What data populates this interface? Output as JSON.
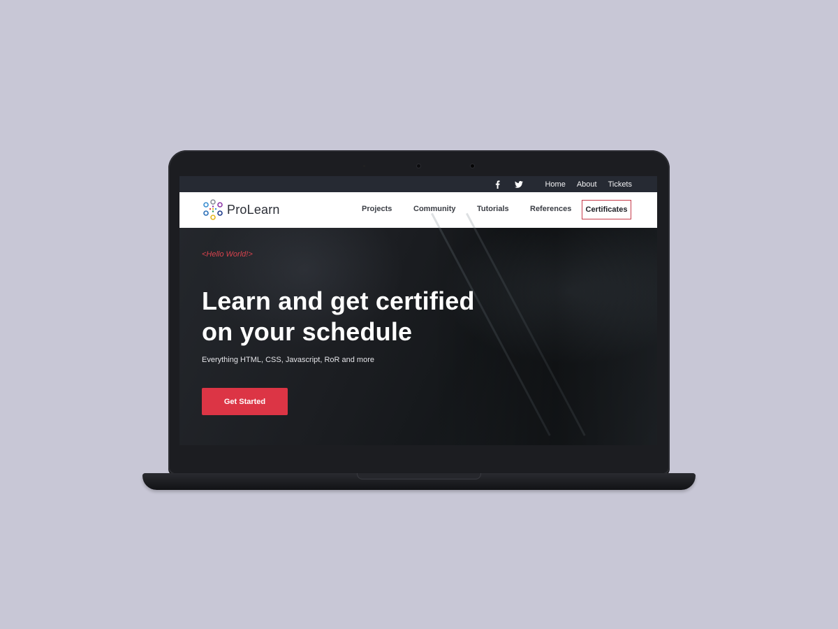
{
  "topbar": {
    "social": [
      {
        "icon": "facebook-icon"
      },
      {
        "icon": "twitter-icon"
      }
    ],
    "links": [
      "Home",
      "About",
      "Tickets"
    ]
  },
  "nav": {
    "brand": "ProLearn",
    "links": [
      "Projects",
      "Community",
      "Tutorials",
      "References"
    ],
    "cta": "Certificates"
  },
  "hero": {
    "tag": "<Hello World!>",
    "title_line1": "Learn and get certified",
    "title_line2": "on your schedule",
    "subtitle": "Everything HTML, CSS, Javascript, RoR and more",
    "cta": "Get Started"
  },
  "colors": {
    "accent": "#dc3545",
    "topbar": "#262a33",
    "page_bg": "#c8c7d6"
  }
}
